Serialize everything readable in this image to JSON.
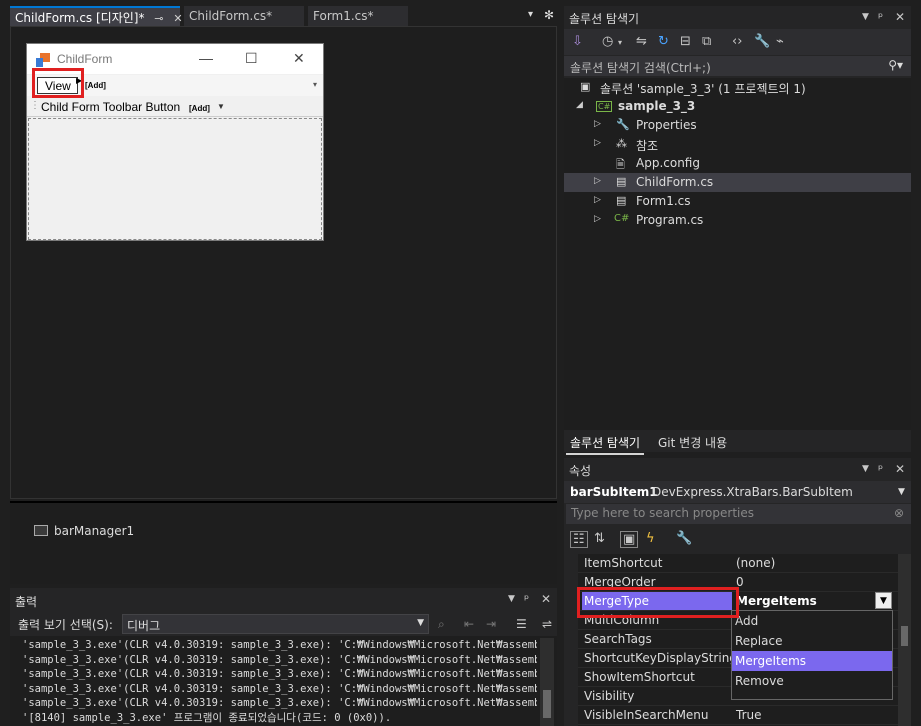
{
  "doc_tabs": [
    {
      "label": "ChildForm.cs [디자인]*",
      "active": true
    },
    {
      "label": "ChildForm.cs*",
      "active": false
    },
    {
      "label": "Form1.cs*",
      "active": false
    }
  ],
  "designer": {
    "form_title": "ChildForm",
    "menu_view": "View",
    "add_tag": "[Add]",
    "toolbar_button": "Child Form Toolbar Button",
    "min_glyph": "—",
    "max_glyph": "☐",
    "close_glyph": "✕"
  },
  "tray": {
    "component": "barManager1"
  },
  "output": {
    "title": "출력",
    "source_label": "출력 보기 선택(S):",
    "source_value": "디버그",
    "lines": [
      "'sample_3_3.exe'(CLR v4.0.30319: sample_3_3.exe): 'C:₩Windows₩Microsoft.Net₩assembly₩G",
      "'sample_3_3.exe'(CLR v4.0.30319: sample_3_3.exe): 'C:₩Windows₩Microsoft.Net₩assembly₩G",
      "'sample_3_3.exe'(CLR v4.0.30319: sample_3_3.exe): 'C:₩Windows₩Microsoft.Net₩assembly₩G",
      "'sample_3_3.exe'(CLR v4.0.30319: sample_3_3.exe): 'C:₩Windows₩Microsoft.Net₩assembly₩G",
      "'sample_3_3.exe'(CLR v4.0.30319: sample_3_3.exe): 'C:₩Windows₩Microsoft.Net₩assembly₩G",
      "'[8140] sample_3_3.exe' 프로그램이 종료되었습니다(코드: 0 (0x0))."
    ]
  },
  "solution_explorer": {
    "title": "솔루션 탐색기",
    "search_placeholder": "솔루션 탐색기 검색(Ctrl+;)",
    "solution_label": "솔루션 'sample_3_3' (1 프로젝트의 1)",
    "project": "sample_3_3",
    "items": [
      {
        "label": "Properties",
        "icon": "wrench-icon"
      },
      {
        "label": "참조",
        "icon": "references-icon"
      },
      {
        "label": "App.config",
        "icon": "config-file-icon"
      },
      {
        "label": "ChildForm.cs",
        "icon": "form-file-icon"
      },
      {
        "label": "Form1.cs",
        "icon": "form-file-icon"
      },
      {
        "label": "Program.cs",
        "icon": "csharp-file-icon"
      }
    ],
    "tabs": [
      "솔루션 탐색기",
      "Git 변경 내용"
    ]
  },
  "properties": {
    "title": "속성",
    "object_name": "barSubItem1",
    "object_type": "DevExpress.XtraBars.BarSubItem",
    "search_placeholder": "Type here to search properties",
    "rows": [
      {
        "name": "ItemShortcut",
        "value": "(none)"
      },
      {
        "name": "MergeOrder",
        "value": "0"
      },
      {
        "name": "MergeType",
        "value": "MergeItems"
      },
      {
        "name": "MultiColumn",
        "value": ""
      },
      {
        "name": "SearchTags",
        "value": ""
      },
      {
        "name": "ShortcutKeyDisplayString",
        "value": ""
      },
      {
        "name": "ShowItemShortcut",
        "value": ""
      },
      {
        "name": "Visibility",
        "value": ""
      },
      {
        "name": "VisibleInSearchMenu",
        "value": "True"
      }
    ],
    "dropdown_options": [
      "Add",
      "Replace",
      "MergeItems",
      "Remove"
    ],
    "selected_option": "MergeItems"
  },
  "colors": {
    "accent": "#0078d4",
    "highlight_purple": "#7b68ee",
    "annotation_red": "#e02020"
  }
}
